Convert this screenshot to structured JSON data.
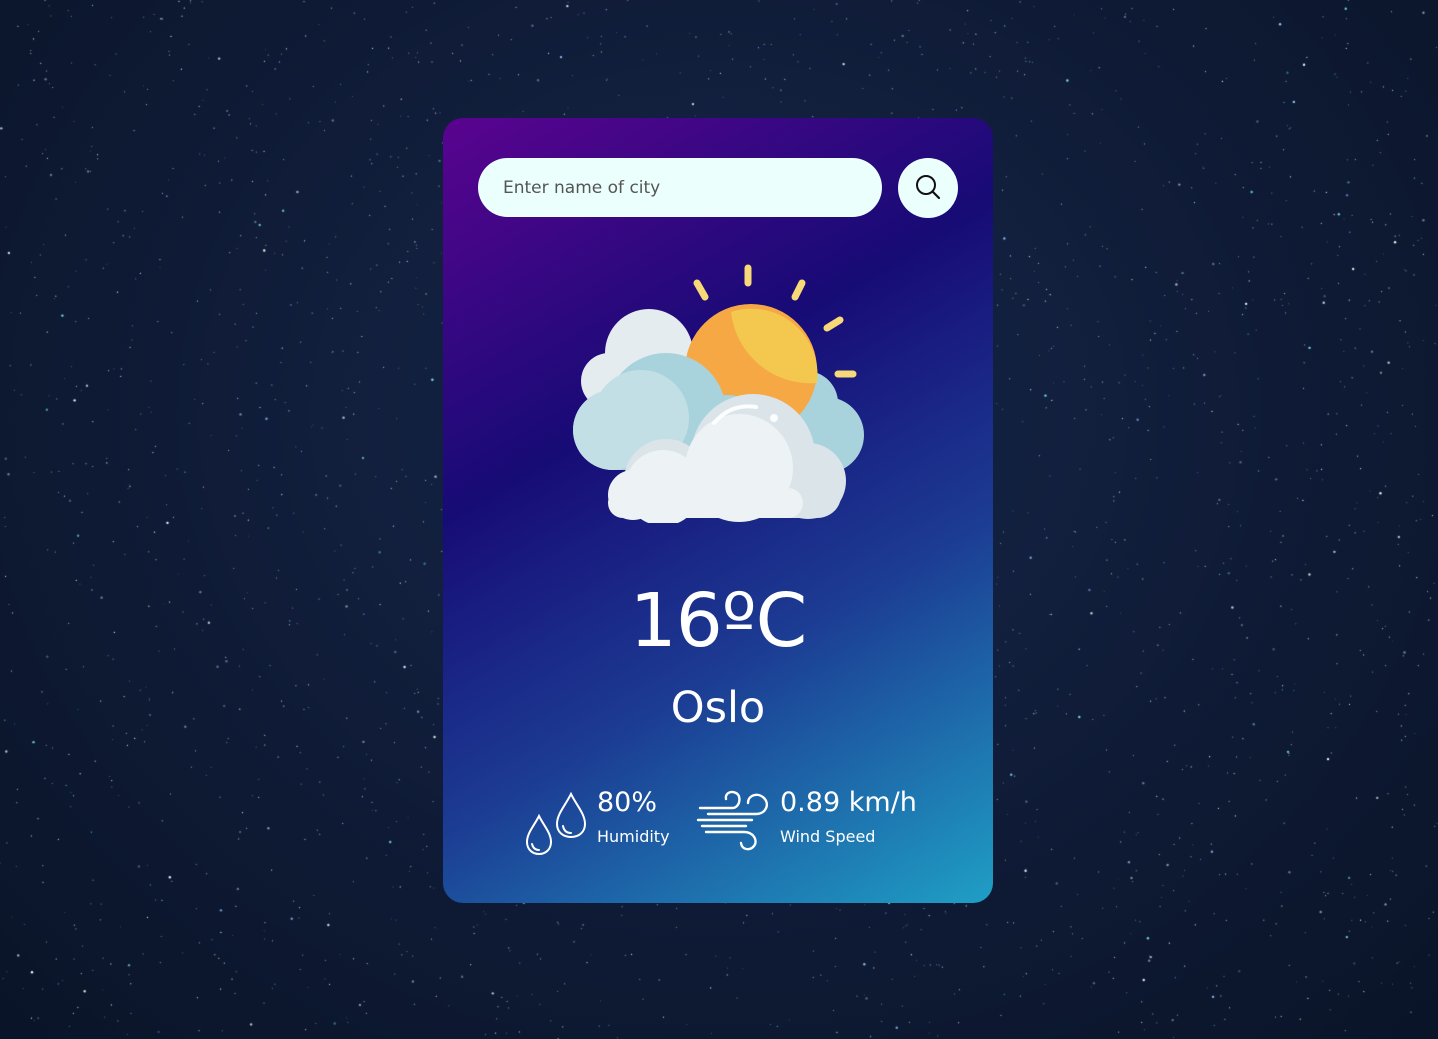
{
  "search": {
    "placeholder": "Enter name of city",
    "value": ""
  },
  "weather": {
    "icon": "cloudy-sun-icon",
    "temperature": "16ºC",
    "city": "Oslo"
  },
  "humidity": {
    "icon": "water-drops-icon",
    "value": "80%",
    "label": "Humidity"
  },
  "wind": {
    "icon": "wind-icon",
    "value": "0.89 km/h",
    "label": "Wind Speed"
  },
  "colors": {
    "background": "#0f1b36",
    "card_gradient_start": "#5a0390",
    "card_gradient_mid": "#170b76",
    "card_gradient_end": "#1f9fc5",
    "input_background": "#ebfffc",
    "sun": "#f6a845",
    "sun_highlight": "#f4c84f",
    "cloud_front": "#edf2f4",
    "cloud_back": "#a9d3dc"
  }
}
